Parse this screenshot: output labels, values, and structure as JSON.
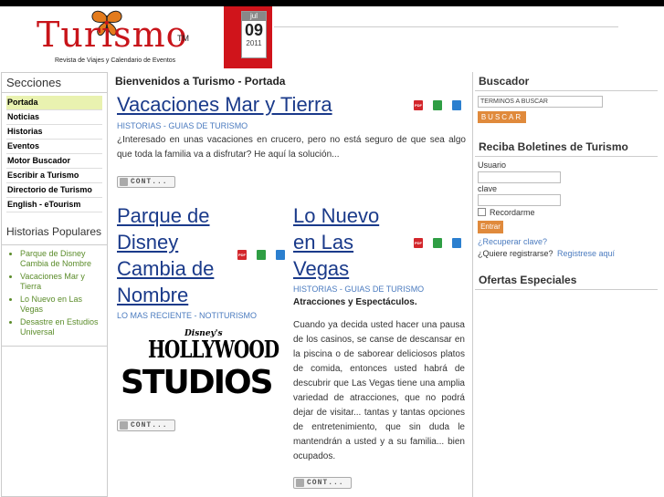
{
  "header": {
    "logo_word": "Turismo",
    "logo_tm": "TM",
    "logo_sub": "Revista de Viajes y Calendario de Eventos",
    "date_month": "jul",
    "date_day": "09",
    "date_year": "2011"
  },
  "sidebar": {
    "title": "Secciones",
    "items": [
      {
        "label": "Portada",
        "active": true
      },
      {
        "label": "Noticias"
      },
      {
        "label": "Historias"
      },
      {
        "label": "Eventos"
      },
      {
        "label": "Motor Buscador"
      },
      {
        "label": "Escribir a Turismo"
      },
      {
        "label": "Directorio de Turismo"
      },
      {
        "label": "English - eTourism"
      }
    ],
    "popular_title": "Historias Populares",
    "popular": [
      "Parque de Disney Cambia de Nombre",
      "Vacaciones Mar y Tierra",
      "Lo Nuevo en Las Vegas",
      "Desastre en Estudios Universal"
    ]
  },
  "main": {
    "welcome": "Bienvenidos a Turismo - Portada",
    "articles": [
      {
        "title": "Vacaciones Mar y Tierra",
        "category": "HISTORIAS - GUIAS DE TURISMO",
        "text": "¿Interesado en unas vacaciones en crucero, pero no está seguro de que sea algo que toda la familia va a disfrutar? He aquí la solución...",
        "cont": "CONT..."
      },
      {
        "title": "Parque de Disney Cambia de Nombre",
        "category": "LO MAS RECIENTE - NOTITURISMO",
        "image_text_1": "Disney's",
        "image_text_2": "HOLLYWOOD",
        "image_text_3": "STUDIOS",
        "cont": "CONT..."
      },
      {
        "title": "Lo Nuevo en Las Vegas",
        "category": "HISTORIAS - GUIAS DE TURISMO",
        "subtitle": "Atracciones y Espectáculos.",
        "text": "Cuando ya decida usted hacer una pausa de los casinos, se canse de descansar en la piscina o de saborear deliciosos platos de comida, entonces usted habrá de descubrir que Las Vegas tiene una amplia variedad de atracciones, que no podrá dejar de visitar... tantas y tantas opciones de entretenimiento, que sin duda le mantendrán a usted y a su familia... bien ocupados.",
        "cont": "CONT..."
      }
    ],
    "icon_pdf": "PDF"
  },
  "right": {
    "buscador_title": "Buscador",
    "search_placeholder": "TERMINOS A BUSCAR",
    "buscar_label": "BUSCAR",
    "boletines_title": "Reciba Boletines de Turismo",
    "usuario_label": "Usuario",
    "clave_label": "clave",
    "recordarme_label": "Recordarme",
    "entrar_label": "Entrar",
    "recuperar_link": "¿Recuperar clave?",
    "registrarse_q": "¿Quiere registrarse?",
    "registrese_link": "Registrese aquí",
    "ofertas_title": "Ofertas Especiales"
  }
}
